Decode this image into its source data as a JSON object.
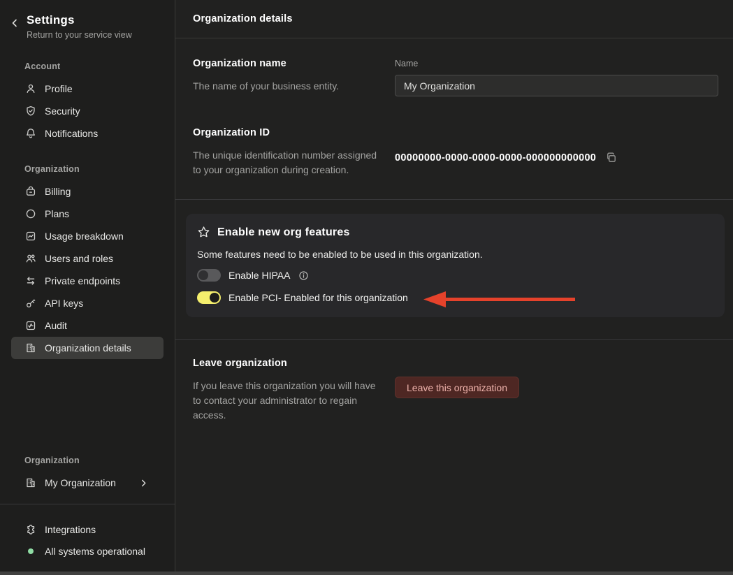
{
  "colors": {
    "accent_yellow": "#f5ef6d",
    "arrow_red": "#e5422b",
    "status_green": "#8fdca4",
    "danger_bg": "#4e2723",
    "danger_text": "#eeb2ab"
  },
  "sidebar": {
    "title": "Settings",
    "subtitle": "Return to your service view",
    "sections": [
      {
        "label": "Account",
        "items": [
          {
            "icon": "user-icon",
            "label": "Profile"
          },
          {
            "icon": "shield-check-icon",
            "label": "Security"
          },
          {
            "icon": "bell-icon",
            "label": "Notifications"
          }
        ]
      },
      {
        "label": "Organization",
        "items": [
          {
            "icon": "wallet-icon",
            "label": "Billing"
          },
          {
            "icon": "circle-icon",
            "label": "Plans"
          },
          {
            "icon": "chart-icon",
            "label": "Usage breakdown"
          },
          {
            "icon": "users-icon",
            "label": "Users and roles"
          },
          {
            "icon": "swap-arrows-icon",
            "label": "Private endpoints"
          },
          {
            "icon": "key-icon",
            "label": "API keys"
          },
          {
            "icon": "audit-icon",
            "label": "Audit"
          },
          {
            "icon": "building-icon",
            "label": "Organization details",
            "selected": true
          }
        ]
      }
    ],
    "org_switcher": {
      "label": "Organization",
      "value": "My Organization"
    },
    "footer": {
      "integrations": "Integrations",
      "status": "All systems operational"
    }
  },
  "header": {
    "title": "Organization details"
  },
  "org_name": {
    "heading": "Organization name",
    "description": "The name of your business entity.",
    "field_label": "Name",
    "field_value": "My Organization"
  },
  "org_id": {
    "heading": "Organization ID",
    "description": "The unique identification number assigned to your organization during creation.",
    "value": "00000000-0000-0000-0000-000000000000"
  },
  "features": {
    "heading": "Enable new org features",
    "description": "Some features need to be enabled to be used in this organization.",
    "toggles": [
      {
        "label": "Enable HIPAA",
        "enabled": false,
        "has_info": true
      },
      {
        "label": "Enable PCI- Enabled for this organization",
        "enabled": true,
        "has_info": false
      }
    ]
  },
  "leave": {
    "heading": "Leave organization",
    "description": "If you leave this organization you will have to contact your administrator to regain access.",
    "button_label": "Leave this organization"
  }
}
